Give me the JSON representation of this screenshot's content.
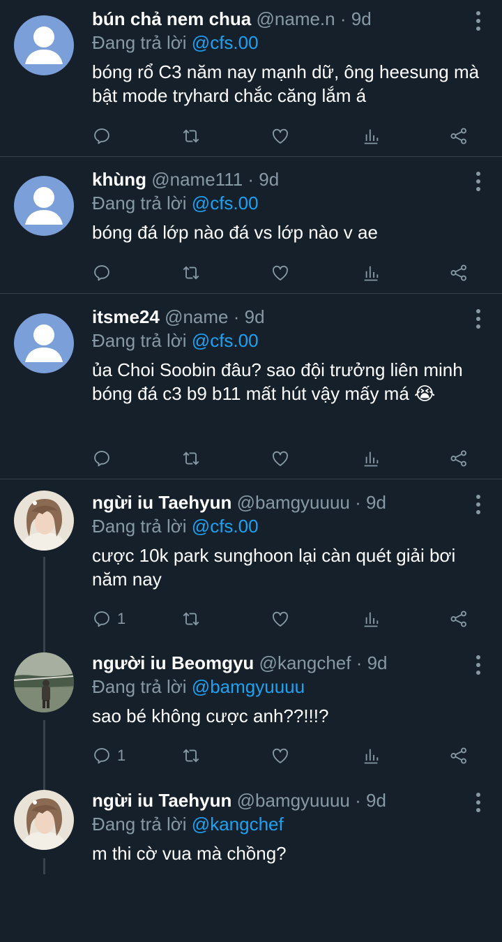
{
  "colors": {
    "background": "#15202b",
    "divider": "#38444d",
    "muted": "#8899a6",
    "link": "#1da1f2",
    "text": "#ffffff"
  },
  "tweets": [
    {
      "name": "bún chả nem chua",
      "handle": "@name.n",
      "time": "· 9d",
      "replying_label": "Đang trả lời",
      "replying_to": "@cfs.00",
      "text": "bóng rổ C3 năm nay mạnh dữ, ông heesung mà bật mode tryhard chắc căng lắm á",
      "reply_count": "",
      "avatar": "default-avatar"
    },
    {
      "name": "khùng",
      "handle": "@name111",
      "time": "· 9d",
      "replying_label": "Đang trả lời",
      "replying_to": "@cfs.00",
      "text": "bóng đá lớp nào đá vs lớp nào v ae",
      "reply_count": "",
      "avatar": "default-avatar"
    },
    {
      "name": "itsme24",
      "handle": "@name",
      "time": "· 9d",
      "replying_label": "Đang trả lời",
      "replying_to": "@cfs.00",
      "text": "ủa Choi Soobin đâu? sao đội trưởng liên minh bóng đá c3 b9 b11 mất hút vậy mấy má 😭",
      "reply_count": "",
      "avatar": "default-avatar"
    },
    {
      "name": "ngừi iu Taehyun",
      "handle": "@bamgyuuuu",
      "time": "· 9d",
      "replying_label": "Đang trả lời",
      "replying_to": "@cfs.00",
      "text": "cược 10k park sunghoon lại càn quét giải bơi năm nay",
      "reply_count": "1",
      "avatar": "photo-avatar-taehyun"
    },
    {
      "name": "người iu Beomgyu",
      "handle": "@kangchef",
      "time": "· 9d",
      "replying_label": "Đang trả lời",
      "replying_to": "@bamgyuuuu",
      "text": "sao bé không cược anh??!!!?",
      "reply_count": "1",
      "avatar": "photo-avatar-beomgyu"
    },
    {
      "name": "ngừi iu Taehyun",
      "handle": "@bamgyuuuu",
      "time": "· 9d",
      "replying_label": "Đang trả lời",
      "replying_to": "@kangchef",
      "text": "m thi cờ vua mà chồng?",
      "reply_count": "",
      "avatar": "photo-avatar-taehyun"
    }
  ]
}
